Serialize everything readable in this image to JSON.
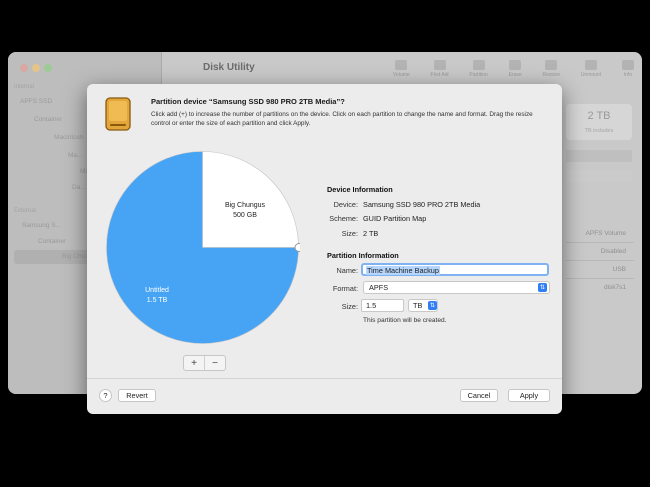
{
  "background_window": {
    "title": "Disk Utility",
    "toolbar": [
      "Volume",
      "First Aid",
      "Partition",
      "Erase",
      "Restore",
      "Unmount",
      "Info"
    ],
    "sidebar": {
      "internal_header": "Internal",
      "items": [
        "APFS SSD",
        "Container",
        "Macintosh",
        "Ma...",
        "Ma...",
        "Da..."
      ],
      "external_header": "External",
      "external_items": [
        "Samsung S...",
        "Container",
        "Big Chu..."
      ]
    },
    "capacity_value": "2 TB",
    "capacity_sub": "TB includes",
    "info_values": [
      "APFS Volume",
      "Disabled",
      "USB",
      "disk7s1"
    ]
  },
  "sheet": {
    "title": "Partition device “Samsung SSD 980 PRO 2TB Media”?",
    "description": "Click add (+) to increase the number of partitions on the device. Click on each partition to change the name and format. Drag the resize control or enter the size of each partition and click Apply.",
    "pie": {
      "slices": [
        {
          "name": "Big Chungus",
          "size": "500 GB",
          "fraction": 0.25,
          "color": "#ffffff"
        },
        {
          "name": "Untitled",
          "size": "1.5 TB",
          "fraction": 0.75,
          "color": "#47a4f5"
        }
      ]
    },
    "add_label": "+",
    "remove_label": "−",
    "device_info": {
      "heading": "Device Information",
      "device_label": "Device:",
      "device_value": "Samsung SSD 980 PRO 2TB Media",
      "scheme_label": "Scheme:",
      "scheme_value": "GUID Partition Map",
      "size_label": "Size:",
      "size_value": "2 TB"
    },
    "partition_info": {
      "heading": "Partition Information",
      "name_label": "Name:",
      "name_value": "Time Machine Backup",
      "format_label": "Format:",
      "format_value": "APFS",
      "size_label": "Size:",
      "size_value": "1.5",
      "unit_value": "TB",
      "note": "This partition will be created."
    },
    "buttons": {
      "help": "?",
      "revert": "Revert",
      "cancel": "Cancel",
      "apply": "Apply"
    }
  }
}
